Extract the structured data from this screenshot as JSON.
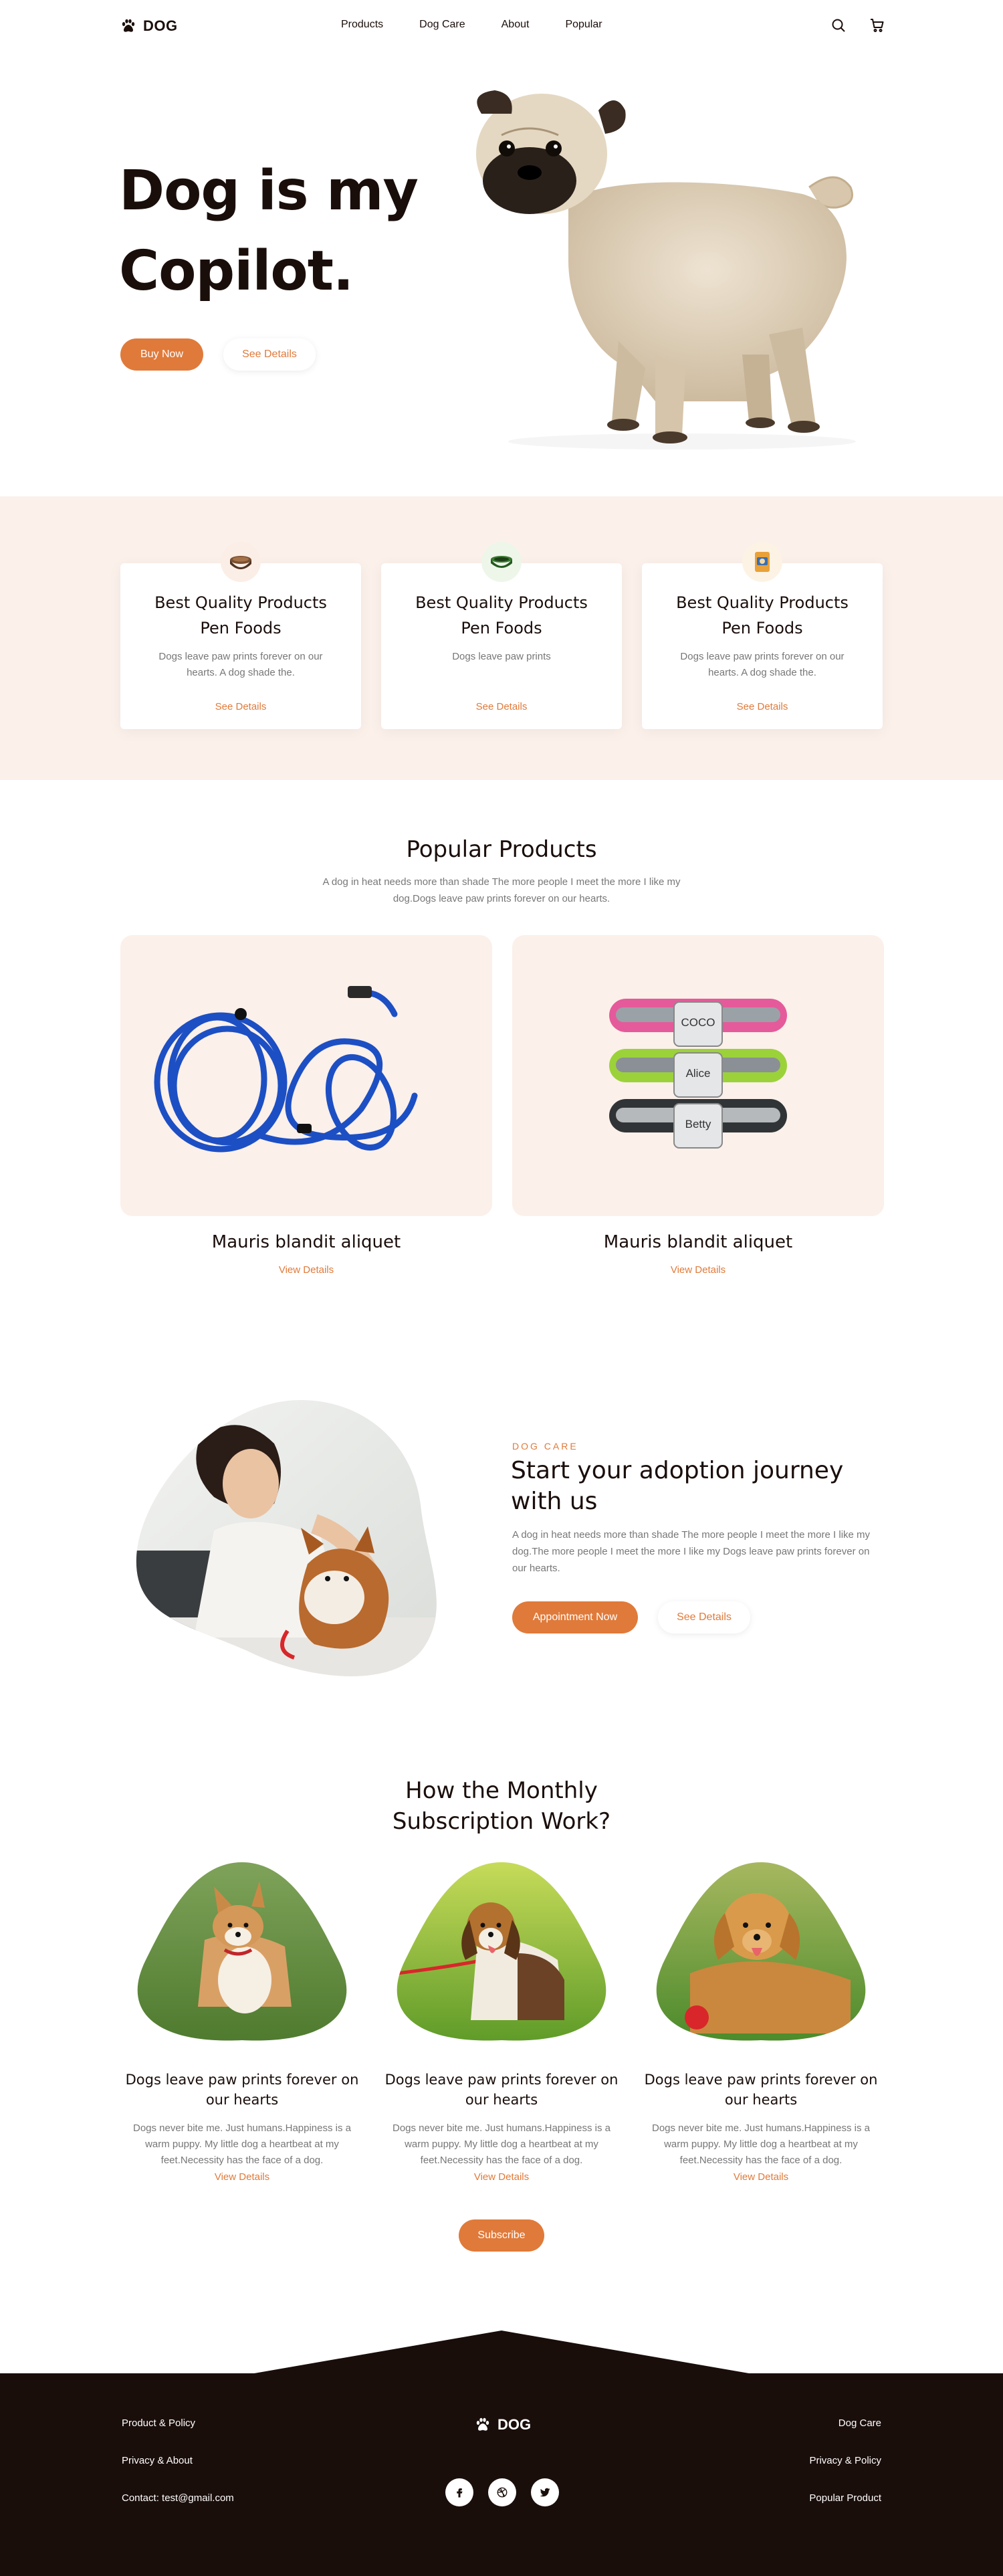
{
  "brand": {
    "name": "DOG",
    "accent": "#e07a3a",
    "dark": "#1a0e0b",
    "cream": "#fbf0ea"
  },
  "nav": {
    "links": [
      "Products",
      "Dog Care",
      "About",
      "Popular"
    ],
    "icons": [
      "search-icon",
      "cart-icon"
    ]
  },
  "hero": {
    "title_line1": "Dog is my",
    "title_line2": "Copilot.",
    "buy_label": "Buy Now",
    "details_label": "See Details"
  },
  "features": [
    {
      "title_line1": "Best Quality Products",
      "title_line2": "Pen Foods",
      "desc": "Dogs leave paw prints forever on our hearts. A dog shade the.",
      "link": "See Details",
      "icon": "food-bowl-icon"
    },
    {
      "title_line1": "Best Quality Products",
      "title_line2": "Pen Foods",
      "desc": "Dogs leave paw prints",
      "link": "See Details",
      "icon": "green-bowl-icon"
    },
    {
      "title_line1": "Best Quality Products",
      "title_line2": "Pen Foods",
      "desc": "Dogs leave paw prints forever on our hearts. A dog shade the.",
      "link": "See Details",
      "icon": "food-bag-icon"
    }
  ],
  "popular": {
    "title": "Popular Products",
    "subtitle": "A dog in heat needs more than shade The more people I meet the more I like my dog.Dogs leave paw prints forever on our hearts.",
    "products": [
      {
        "name": "Mauris blandit aliquet",
        "link": "View Details",
        "image": "blue-leash"
      },
      {
        "name": "Mauris blandit aliquet",
        "link": "View Details",
        "image": "dog-collars"
      }
    ],
    "collar_tags": [
      "COCO",
      "Alice",
      "Betty"
    ]
  },
  "adoption": {
    "eyebrow": "DOG CARE",
    "title": "Start your adoption journey with us",
    "desc": "A dog in heat needs more than shade The more people I meet the more I like my dog.The more people I meet the more I like my Dogs leave paw prints forever on our hearts.",
    "appointment_label": "Appointment Now",
    "details_label": "See Details"
  },
  "subscription": {
    "title_line1": "How the Monthly",
    "title_line2": "Subscription Work?",
    "cards": [
      {
        "title": "Dogs leave paw prints forever on our hearts",
        "desc": "Dogs never bite me. Just humans.Happiness is a warm puppy. My little dog a heartbeat at my feet.Necessity has the face of a dog.",
        "link": "View Details",
        "image": "corgi"
      },
      {
        "title": "Dogs leave paw prints forever on our hearts",
        "desc": "Dogs never bite me. Just humans.Happiness is a warm puppy. My little dog a heartbeat at my feet.Necessity has the face of a dog.",
        "link": "View Details",
        "image": "beagle"
      },
      {
        "title": "Dogs leave paw prints forever on our hearts",
        "desc": "Dogs never bite me. Just humans.Happiness is a warm puppy. My little dog a heartbeat at my feet.Necessity has the face of a dog.",
        "link": "View Details",
        "image": "golden-retriever"
      }
    ],
    "subscribe_label": "Subscribe"
  },
  "footer": {
    "left": [
      "Product & Policy",
      "Privacy & About",
      "Contact:  test@gmail.com"
    ],
    "right": [
      "Dog Care",
      "Privacy & Policy",
      "Popular Product"
    ],
    "social": [
      "facebook-icon",
      "dribbble-icon",
      "twitter-icon"
    ]
  }
}
